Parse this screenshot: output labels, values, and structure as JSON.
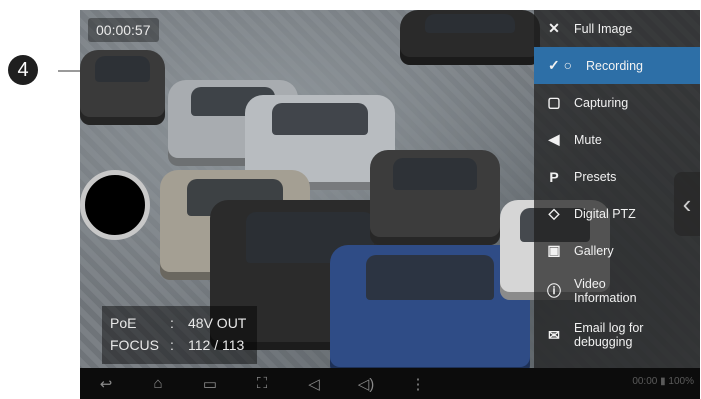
{
  "callout": {
    "number": "4"
  },
  "player": {
    "timer": "00:00:57",
    "info": {
      "rows": [
        {
          "label": "PoE",
          "sep": ":",
          "value": "48V OUT"
        },
        {
          "label": "FOCUS",
          "sep": ":",
          "value": "112 / 113"
        }
      ]
    }
  },
  "menu": {
    "items": [
      {
        "label": "Full Image",
        "icon": "✕",
        "active": false
      },
      {
        "label": "Recording",
        "icon": "✓ ○",
        "active": true
      },
      {
        "label": "Capturing",
        "icon": "▢",
        "active": false
      },
      {
        "label": "Mute",
        "icon": "◀",
        "active": false
      },
      {
        "label": "Presets",
        "icon": "P",
        "active": false
      },
      {
        "label": "Digital PTZ",
        "icon": "◇",
        "active": false
      },
      {
        "label": "Gallery",
        "icon": "▣",
        "active": false
      },
      {
        "label": "Video\nInformation",
        "icon": "ⓘ",
        "active": false
      },
      {
        "label": "Email log for\ndebugging",
        "icon": "✉",
        "active": false
      }
    ]
  },
  "navbar": {
    "icons": [
      "back-icon",
      "home-icon",
      "recent-apps-icon",
      "screenshot-icon",
      "volume-down-icon",
      "volume-up-icon",
      "more-icon"
    ]
  },
  "status": {
    "time": "00:00",
    "battery": "100%"
  }
}
